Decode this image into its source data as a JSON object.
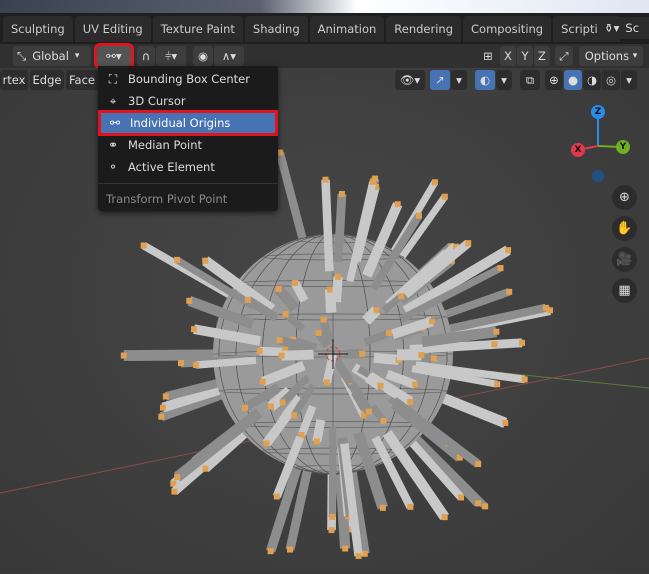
{
  "workspace_tabs": [
    "Sculpting",
    "UV Editing",
    "Texture Paint",
    "Shading",
    "Animation",
    "Rendering",
    "Compositing",
    "Scripting"
  ],
  "add_tab": "+",
  "scene_label": "Sc",
  "toolbar": {
    "orientation": "Global",
    "axes": [
      "X",
      "Y",
      "Z"
    ],
    "options": "Options"
  },
  "select_modes": [
    "rtex",
    "Edge",
    "Face"
  ],
  "pivot_menu": {
    "items": [
      {
        "label": "Bounding Box Center",
        "icon": "bounding-box-icon"
      },
      {
        "label": "3D Cursor",
        "icon": "cursor-icon"
      },
      {
        "label": "Individual Origins",
        "icon": "individual-origins-icon",
        "selected": true
      },
      {
        "label": "Median Point",
        "icon": "median-point-icon"
      },
      {
        "label": "Active Element",
        "icon": "active-element-icon"
      }
    ],
    "title": "Transform Pivot Point"
  },
  "gizmo": {
    "x": "X",
    "y": "Y",
    "z": "Z"
  },
  "colors": {
    "selected": "#4772b3",
    "highlight": "#e0141e",
    "x": "#e0394c",
    "y": "#6fb022",
    "z": "#2a8ae8"
  }
}
